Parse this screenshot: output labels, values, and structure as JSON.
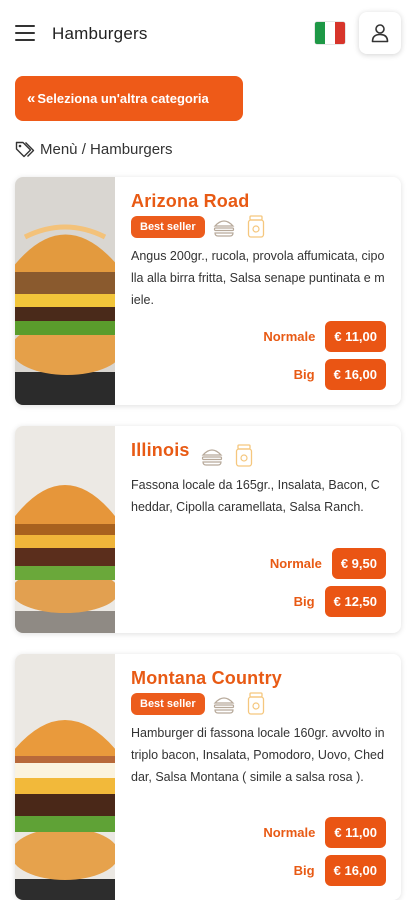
{
  "header": {
    "title": "Hamburgers",
    "menu_icon": "hamburger-menu-icon",
    "flag_colors": [
      "#1e9846",
      "#ffffff",
      "#d7352b"
    ],
    "user_icon": "user-icon"
  },
  "back_button": {
    "label": "Seleziona un'altra categoria",
    "icon": "double-chevron-left-icon"
  },
  "breadcrumb": {
    "icon": "tags-icon",
    "text": "Menù / Hamburgers"
  },
  "accent_color": "#ea5514",
  "products": [
    {
      "name": "Arizona Road",
      "badge": "Best seller",
      "description": "Angus 200gr., rucola, provola affumicata, cipolla alla birra fritta, Salsa senape puntinata e miele.",
      "prices": [
        {
          "label": "Normale",
          "price": "€ 11,00"
        },
        {
          "label": "Big",
          "price": "€ 16,00"
        }
      ]
    },
    {
      "name": "Illinois",
      "badge": "",
      "description": "Fassona locale da 165gr., Insalata, Bacon, Cheddar, Cipolla caramellata, Salsa Ranch.",
      "prices": [
        {
          "label": "Normale",
          "price": "€ 9,50"
        },
        {
          "label": "Big",
          "price": "€ 12,50"
        }
      ]
    },
    {
      "name": "Montana Country",
      "badge": "Best seller",
      "description": "Hamburger di fassona locale 160gr. avvolto in triplo bacon, Insalata, Pomodoro, Uovo, Cheddar, Salsa Montana ( simile a salsa rosa ).",
      "prices": [
        {
          "label": "Normale",
          "price": "€ 11,00"
        },
        {
          "label": "Big",
          "price": "€ 16,00"
        }
      ]
    }
  ]
}
